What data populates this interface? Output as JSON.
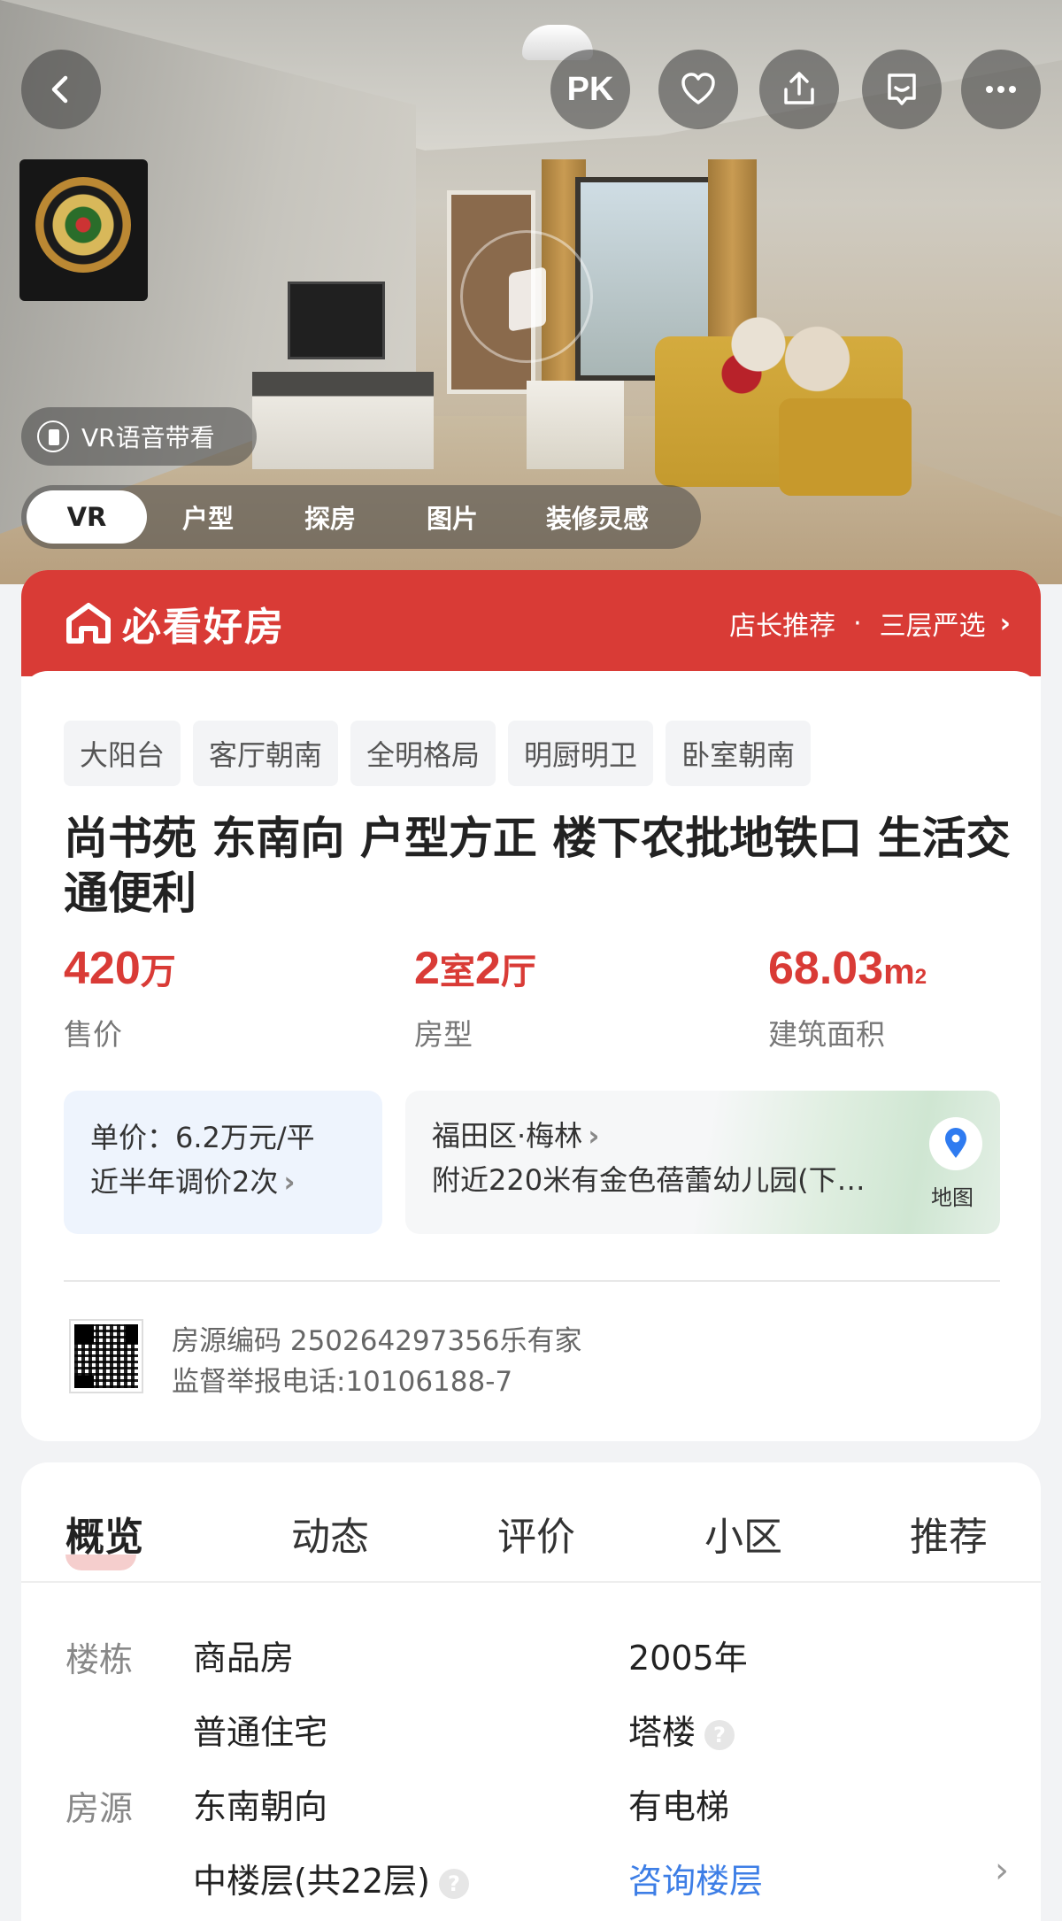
{
  "header": {
    "pk_label": "PK",
    "vr_voice_label": "VR语音带看",
    "media_tabs": [
      "VR",
      "户型",
      "探房",
      "图片",
      "装修灵感"
    ]
  },
  "banner": {
    "brand": "必看好房",
    "right_a": "店长推荐",
    "separator": "·",
    "right_b": "三层严选"
  },
  "listing": {
    "tags": [
      "大阳台",
      "客厅朝南",
      "全明格局",
      "明厨明卫",
      "卧室朝南"
    ],
    "title": "尚书苑 东南向 户型方正 楼下农批地铁口 生活交通便利",
    "price": {
      "value": "420",
      "unit": "万",
      "label": "售价"
    },
    "layout": {
      "rooms": "2",
      "rooms_unit": "室",
      "halls": "2",
      "halls_unit": "厅",
      "label": "房型"
    },
    "area": {
      "value": "68.03",
      "unit": "m",
      "unit_sup": "2",
      "label": "建筑面积"
    },
    "unit_price": "单价：6.2万元/平",
    "price_adjust": "近半年调价2次",
    "district": "福田区·梅林",
    "nearby": "附近220米有金色蓓蕾幼儿园(下…",
    "map_label": "地图",
    "code_line": "房源编码 250264297356乐有家",
    "report_line": "监督举报电话:10106188-7"
  },
  "nav": {
    "items": [
      "概览",
      "动态",
      "评价",
      "小区",
      "推荐"
    ]
  },
  "overview": {
    "building_label": "楼栋",
    "building_type": "商品房",
    "year": "2005年",
    "usage": "普通住宅",
    "structure": "塔楼",
    "source_label": "房源",
    "orientation": "东南朝向",
    "elevator": "有电梯",
    "floor": "中楼层(共22层)",
    "floor_link": "咨询楼层"
  },
  "colors": {
    "accent": "#d93b36",
    "link": "#3d7ee6"
  }
}
